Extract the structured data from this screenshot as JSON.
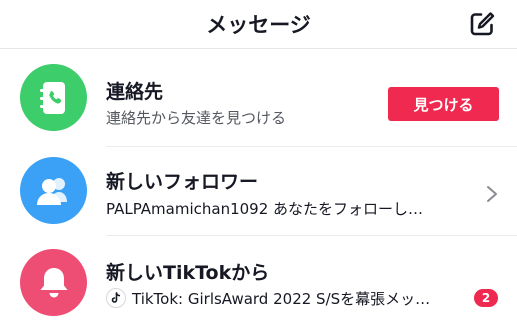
{
  "header": {
    "title": "メッセージ",
    "compose_icon": "compose-icon"
  },
  "rows": [
    {
      "title": "連絡先",
      "subtitle": "連絡先から友達を見つける",
      "icon": "contacts-book-icon",
      "avatar_color": "#3ecd6b",
      "action_label": "見つける"
    },
    {
      "title": "新しいフォロワー",
      "subtitle": "PALPAmamichan1092 あなたをフォローし…",
      "icon": "people-icon",
      "avatar_color": "#3aa1f6"
    },
    {
      "title": "新しいTikTokから",
      "subtitle": "TikTok: GirlsAward 2022 S/Sを幕張メッ…",
      "icon": "bell-icon",
      "avatar_color": "#ef4e74",
      "badge": "2"
    }
  ],
  "colors": {
    "accent": "#ef2950",
    "title_text": "#161823",
    "subtitle_text": "#555860"
  }
}
